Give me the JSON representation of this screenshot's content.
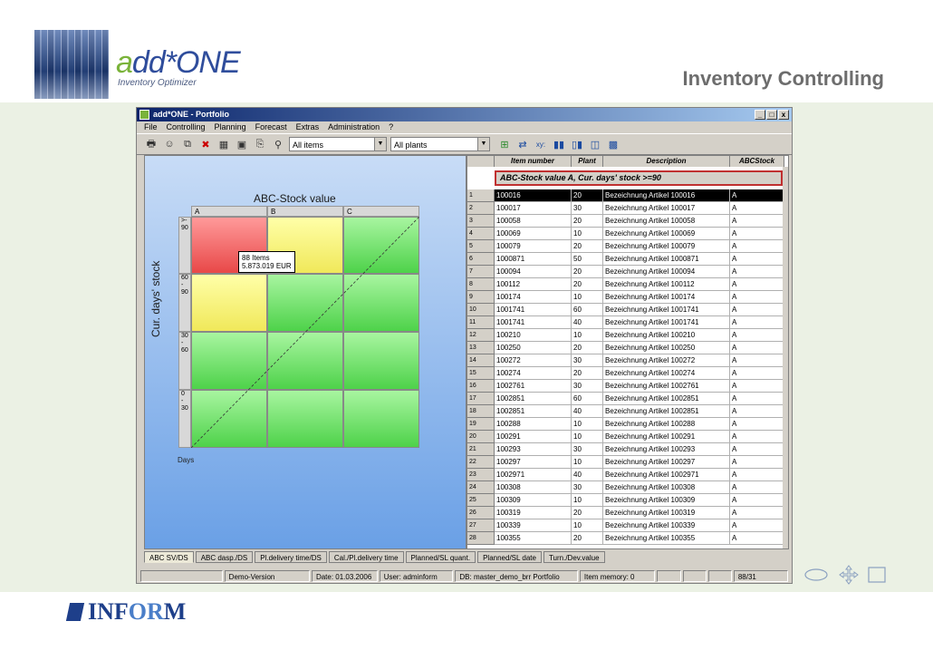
{
  "header": {
    "brand_prefix": "a",
    "brand_rest": "dd*ONE",
    "brand_sub": "Inventory Optimizer",
    "slide_title": "Inventory Controlling"
  },
  "window": {
    "title": "add*ONE - Portfolio",
    "controls": [
      "_",
      "□",
      "x"
    ]
  },
  "menu": [
    "File",
    "Controlling",
    "Planning",
    "Forecast",
    "Extras",
    "Administration",
    "?"
  ],
  "toolbar": {
    "items_select": "All items",
    "plants_select": "All plants",
    "xy_label": "xy:"
  },
  "chart": {
    "title": "ABC-Stock value",
    "ylabel": "Cur. days' stock",
    "xlabel": "Days",
    "columns": [
      "A",
      "B",
      "C"
    ],
    "rows": [
      ">-\n90",
      "60\n-\n90",
      "30\n-\n60",
      "0\n-\n30"
    ],
    "tooltip_line1": "88 Items",
    "tooltip_line2": "5.873.019 EUR"
  },
  "table": {
    "headers": [
      "",
      "Item number",
      "Plant",
      "Description",
      "ABCStock"
    ],
    "filter": "ABC-Stock value A, Cur. days' stock >=90",
    "rows": [
      [
        "1",
        "100016",
        "20",
        "Bezeichnung Artikel 100016",
        "A"
      ],
      [
        "2",
        "100017",
        "30",
        "Bezeichnung Artikel 100017",
        "A"
      ],
      [
        "3",
        "100058",
        "20",
        "Bezeichnung Artikel 100058",
        "A"
      ],
      [
        "4",
        "100069",
        "10",
        "Bezeichnung Artikel 100069",
        "A"
      ],
      [
        "5",
        "100079",
        "20",
        "Bezeichnung Artikel 100079",
        "A"
      ],
      [
        "6",
        "1000871",
        "50",
        "Bezeichnung Artikel 1000871",
        "A"
      ],
      [
        "7",
        "100094",
        "20",
        "Bezeichnung Artikel 100094",
        "A"
      ],
      [
        "8",
        "100112",
        "20",
        "Bezeichnung Artikel 100112",
        "A"
      ],
      [
        "9",
        "100174",
        "10",
        "Bezeichnung Artikel 100174",
        "A"
      ],
      [
        "10",
        "1001741",
        "60",
        "Bezeichnung Artikel 1001741",
        "A"
      ],
      [
        "11",
        "1001741",
        "40",
        "Bezeichnung Artikel 1001741",
        "A"
      ],
      [
        "12",
        "100210",
        "10",
        "Bezeichnung Artikel 100210",
        "A"
      ],
      [
        "13",
        "100250",
        "20",
        "Bezeichnung Artikel 100250",
        "A"
      ],
      [
        "14",
        "100272",
        "30",
        "Bezeichnung Artikel 100272",
        "A"
      ],
      [
        "15",
        "100274",
        "20",
        "Bezeichnung Artikel 100274",
        "A"
      ],
      [
        "16",
        "1002761",
        "30",
        "Bezeichnung Artikel 1002761",
        "A"
      ],
      [
        "17",
        "1002851",
        "60",
        "Bezeichnung Artikel 1002851",
        "A"
      ],
      [
        "18",
        "1002851",
        "40",
        "Bezeichnung Artikel 1002851",
        "A"
      ],
      [
        "19",
        "100288",
        "10",
        "Bezeichnung Artikel 100288",
        "A"
      ],
      [
        "20",
        "100291",
        "10",
        "Bezeichnung Artikel 100291",
        "A"
      ],
      [
        "21",
        "100293",
        "30",
        "Bezeichnung Artikel 100293",
        "A"
      ],
      [
        "22",
        "100297",
        "10",
        "Bezeichnung Artikel 100297",
        "A"
      ],
      [
        "23",
        "1002971",
        "40",
        "Bezeichnung Artikel 1002971",
        "A"
      ],
      [
        "24",
        "100308",
        "30",
        "Bezeichnung Artikel 100308",
        "A"
      ],
      [
        "25",
        "100309",
        "10",
        "Bezeichnung Artikel 100309",
        "A"
      ],
      [
        "26",
        "100319",
        "20",
        "Bezeichnung Artikel 100319",
        "A"
      ],
      [
        "27",
        "100339",
        "10",
        "Bezeichnung Artikel 100339",
        "A"
      ],
      [
        "28",
        "100355",
        "20",
        "Bezeichnung Artikel 100355",
        "A"
      ]
    ]
  },
  "tabs": [
    "ABC SV/DS",
    "ABC dasp./DS",
    "Pl.delivery time/DS",
    "Cal./Pl.delivery time",
    "Planned/SL quant.",
    "Planned/SL date",
    "Turn./Dev.value"
  ],
  "status": [
    "",
    "Demo-Version",
    "Date: 01.03.2006",
    "User: adminform",
    "DB: master_demo_brr Portfolio",
    "Item memory: 0",
    "",
    "",
    "",
    "88/31"
  ],
  "footer": {
    "logo_i": "INF",
    "logo_or": "OR",
    "logo_m": "M"
  }
}
